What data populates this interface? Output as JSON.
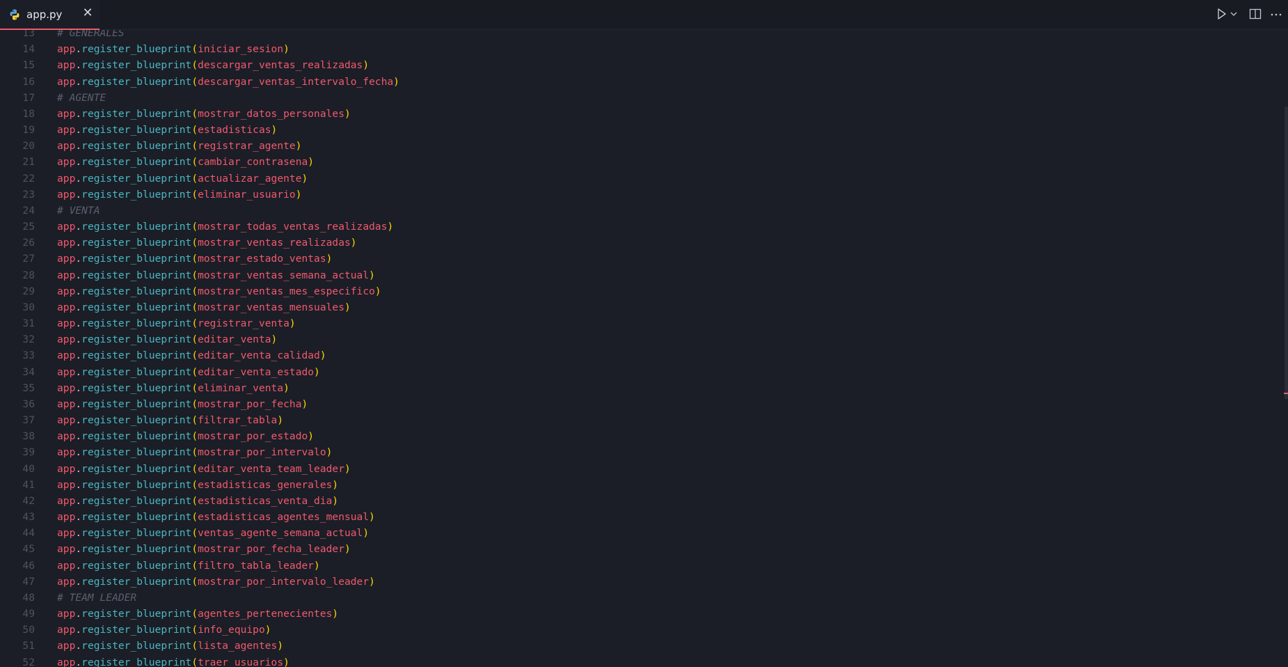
{
  "tab": {
    "title": "app.py",
    "icon": "python-file-icon",
    "close_glyph": "✕",
    "active_accent": "#f1596f"
  },
  "colors": {
    "background": "#1b1e26",
    "identifier": "#f1596f",
    "method": "#4bb7c4",
    "bracket": "#ffd700",
    "comment": "#5b6070",
    "line_number": "#4e5362"
  },
  "toolbar": {
    "run_icon": "play-icon",
    "run_menu_icon": "chevron-down-icon",
    "split_icon": "split-editor-icon",
    "more_icon": "more-actions-icon"
  },
  "code": {
    "object": "app",
    "method": "register_blueprint",
    "lines": [
      {
        "n": "13",
        "comment": "# GENERALES"
      },
      {
        "n": "14",
        "arg": "iniciar_sesion"
      },
      {
        "n": "15",
        "arg": "descargar_ventas_realizadas"
      },
      {
        "n": "16",
        "arg": "descargar_ventas_intervalo_fecha"
      },
      {
        "n": "17",
        "comment": "# AGENTE"
      },
      {
        "n": "18",
        "arg": "mostrar_datos_personales"
      },
      {
        "n": "19",
        "arg": "estadisticas"
      },
      {
        "n": "20",
        "arg": "registrar_agente"
      },
      {
        "n": "21",
        "arg": "cambiar_contrasena"
      },
      {
        "n": "22",
        "arg": "actualizar_agente"
      },
      {
        "n": "23",
        "arg": "eliminar_usuario"
      },
      {
        "n": "24",
        "comment": "# VENTA"
      },
      {
        "n": "25",
        "arg": "mostrar_todas_ventas_realizadas"
      },
      {
        "n": "26",
        "arg": "mostrar_ventas_realizadas"
      },
      {
        "n": "27",
        "arg": "mostrar_estado_ventas"
      },
      {
        "n": "28",
        "arg": "mostrar_ventas_semana_actual"
      },
      {
        "n": "29",
        "arg": "mostrar_ventas_mes_especifico"
      },
      {
        "n": "30",
        "arg": "mostrar_ventas_mensuales"
      },
      {
        "n": "31",
        "arg": "registrar_venta"
      },
      {
        "n": "32",
        "arg": "editar_venta"
      },
      {
        "n": "33",
        "arg": "editar_venta_calidad"
      },
      {
        "n": "34",
        "arg": "editar_venta_estado"
      },
      {
        "n": "35",
        "arg": "eliminar_venta"
      },
      {
        "n": "36",
        "arg": "mostrar_por_fecha"
      },
      {
        "n": "37",
        "arg": "filtrar_tabla"
      },
      {
        "n": "38",
        "arg": "mostrar_por_estado"
      },
      {
        "n": "39",
        "arg": "mostrar_por_intervalo"
      },
      {
        "n": "40",
        "arg": "editar_venta_team_leader"
      },
      {
        "n": "41",
        "arg": "estadisticas_generales"
      },
      {
        "n": "42",
        "arg": "estadisticas_venta_dia"
      },
      {
        "n": "43",
        "arg": "estadisticas_agentes_mensual"
      },
      {
        "n": "44",
        "arg": "ventas_agente_semana_actual"
      },
      {
        "n": "45",
        "arg": "mostrar_por_fecha_leader"
      },
      {
        "n": "46",
        "arg": "filtro_tabla_leader"
      },
      {
        "n": "47",
        "arg": "mostrar_por_intervalo_leader"
      },
      {
        "n": "48",
        "comment": "# TEAM LEADER"
      },
      {
        "n": "49",
        "arg": "agentes_pertenecientes"
      },
      {
        "n": "50",
        "arg": "info_equipo"
      },
      {
        "n": "51",
        "arg": "lista_agentes"
      },
      {
        "n": "52",
        "arg": "traer_usuarios"
      }
    ]
  }
}
